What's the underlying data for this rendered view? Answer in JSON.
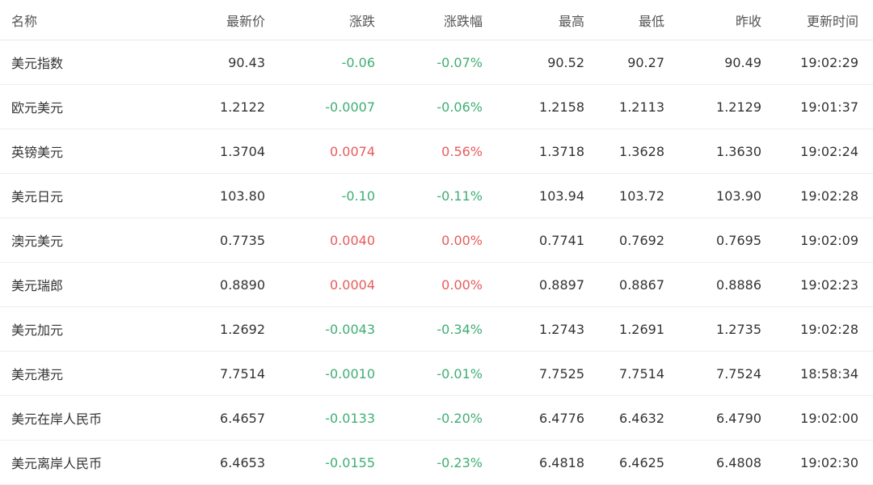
{
  "colors": {
    "up": "#e85b5b",
    "down": "#3fae74",
    "text": "#333333"
  },
  "table": {
    "headers": {
      "name": "名称",
      "latest": "最新价",
      "change": "涨跌",
      "change_pct": "涨跌幅",
      "high": "最高",
      "low": "最低",
      "prev_close": "昨收",
      "updated": "更新时间"
    },
    "rows": [
      {
        "name": "美元指数",
        "latest": "90.43",
        "change": "-0.06",
        "change_pct": "-0.07%",
        "high": "90.52",
        "low": "90.27",
        "prev_close": "90.49",
        "updated": "19:02:29",
        "trend": "down"
      },
      {
        "name": "欧元美元",
        "latest": "1.2122",
        "change": "-0.0007",
        "change_pct": "-0.06%",
        "high": "1.2158",
        "low": "1.2113",
        "prev_close": "1.2129",
        "updated": "19:01:37",
        "trend": "down"
      },
      {
        "name": "英镑美元",
        "latest": "1.3704",
        "change": "0.0074",
        "change_pct": "0.56%",
        "high": "1.3718",
        "low": "1.3628",
        "prev_close": "1.3630",
        "updated": "19:02:24",
        "trend": "up"
      },
      {
        "name": "美元日元",
        "latest": "103.80",
        "change": "-0.10",
        "change_pct": "-0.11%",
        "high": "103.94",
        "low": "103.72",
        "prev_close": "103.90",
        "updated": "19:02:28",
        "trend": "down"
      },
      {
        "name": "澳元美元",
        "latest": "0.7735",
        "change": "0.0040",
        "change_pct": "0.00%",
        "high": "0.7741",
        "low": "0.7692",
        "prev_close": "0.7695",
        "updated": "19:02:09",
        "trend": "up"
      },
      {
        "name": "美元瑞郎",
        "latest": "0.8890",
        "change": "0.0004",
        "change_pct": "0.00%",
        "high": "0.8897",
        "low": "0.8867",
        "prev_close": "0.8886",
        "updated": "19:02:23",
        "trend": "up"
      },
      {
        "name": "美元加元",
        "latest": "1.2692",
        "change": "-0.0043",
        "change_pct": "-0.34%",
        "high": "1.2743",
        "low": "1.2691",
        "prev_close": "1.2735",
        "updated": "19:02:28",
        "trend": "down"
      },
      {
        "name": "美元港元",
        "latest": "7.7514",
        "change": "-0.0010",
        "change_pct": "-0.01%",
        "high": "7.7525",
        "low": "7.7514",
        "prev_close": "7.7524",
        "updated": "18:58:34",
        "trend": "down"
      },
      {
        "name": "美元在岸人民币",
        "latest": "6.4657",
        "change": "-0.0133",
        "change_pct": "-0.20%",
        "high": "6.4776",
        "low": "6.4632",
        "prev_close": "6.4790",
        "updated": "19:02:00",
        "trend": "down"
      },
      {
        "name": "美元离岸人民币",
        "latest": "6.4653",
        "change": "-0.0155",
        "change_pct": "-0.23%",
        "high": "6.4818",
        "low": "6.4625",
        "prev_close": "6.4808",
        "updated": "19:02:30",
        "trend": "down"
      }
    ]
  }
}
